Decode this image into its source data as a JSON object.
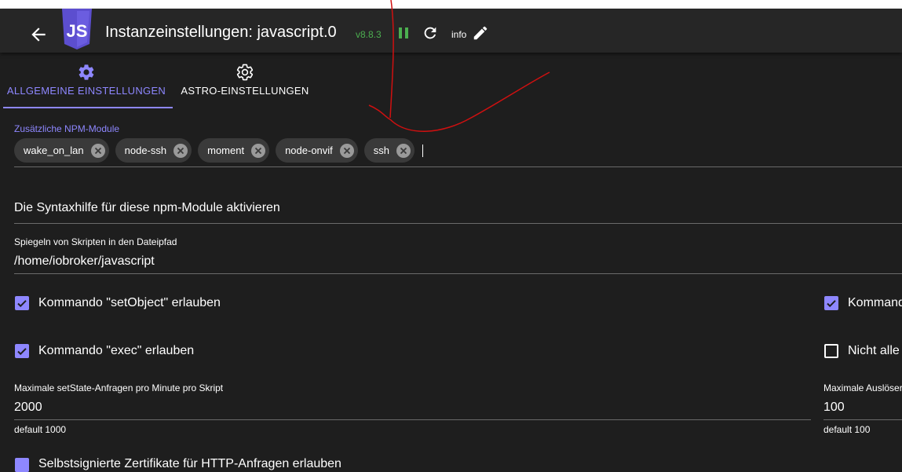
{
  "header": {
    "title": "Instanzeinstellungen: javascript.0",
    "version": "v8.8.3",
    "info_label": "info",
    "version_color": "#4caf50",
    "logo_color": "#5c4ecf"
  },
  "tabs": [
    {
      "label": "ALLGEMEINE EINSTELLUNGEN",
      "icon": "gear-filled-icon",
      "active": true
    },
    {
      "label": "ASTRO-EINSTELLUNGEN",
      "icon": "gear-outline-icon",
      "active": false
    }
  ],
  "accent_color": "#8e87ff",
  "npm_modules": {
    "label": "Zusätzliche NPM-Module",
    "chips": [
      "wake_on_lan",
      "node-ssh",
      "moment",
      "node-onvif",
      "ssh"
    ]
  },
  "syntax_help": {
    "label": "Die Syntaxhilfe für diese npm-Module aktivieren"
  },
  "mirror": {
    "label": "Spiegeln von Skripten in den Dateipfad",
    "value": "/home/iobroker/javascript"
  },
  "checkboxes": {
    "set_object": {
      "label": "Kommando \"setObject\" erlauben",
      "checked": true
    },
    "right_top": {
      "label": "Kommand",
      "checked": true
    },
    "exec": {
      "label": "Kommando \"exec\" erlauben",
      "checked": true
    },
    "right_bottom": {
      "label": "Nicht alle",
      "checked": false
    },
    "bottom_partial": {
      "label": "Selbstsignierte Zertifikate für HTTP-Anfragen erlauben",
      "checked": true
    }
  },
  "max_setstate": {
    "label": "Maximale setState-Anfragen pro Minute pro Skript",
    "value": "2000",
    "help": "default 1000"
  },
  "max_triggers": {
    "label": "Maximale Auslöser",
    "value": "100",
    "help": "default 100"
  }
}
